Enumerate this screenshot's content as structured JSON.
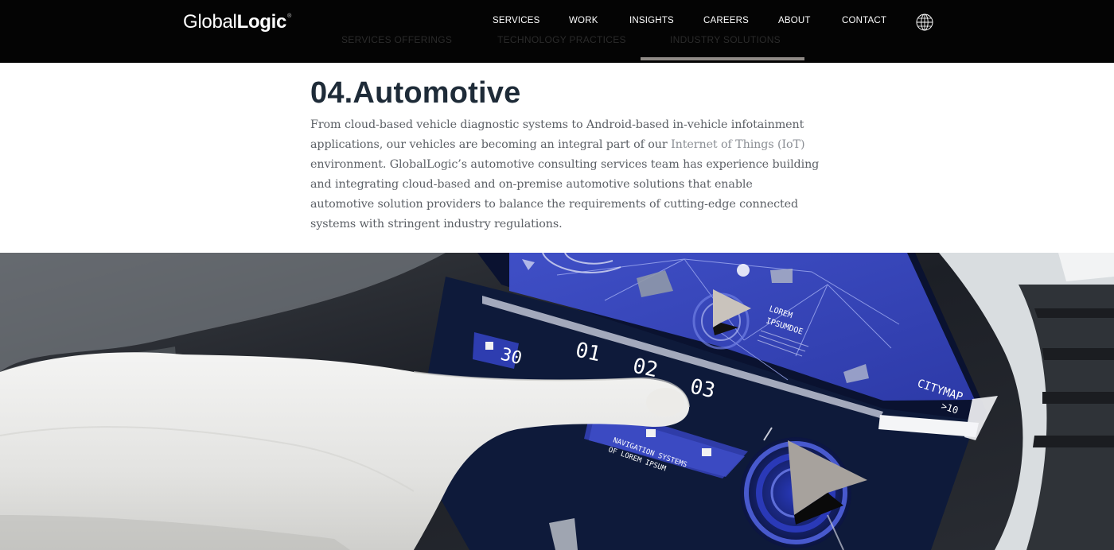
{
  "header": {
    "logo": {
      "light": "Global",
      "bold": "Logic",
      "mark": "®"
    },
    "nav": [
      "SERVICES",
      "WORK",
      "INSIGHTS",
      "CAREERS",
      "ABOUT",
      "CONTACT"
    ],
    "subnav": [
      "SERVICES OFFERINGS",
      "TECHNOLOGY PRACTICES",
      "INDUSTRY SOLUTIONS"
    ],
    "active_subnav": "INDUSTRY SOLUTIONS"
  },
  "section": {
    "title": "04.Automotive",
    "body_before_link": "From cloud-based vehicle diagnostic systems to Android-based in-vehicle infotainment applications, our vehicles are becoming an integral part of our ",
    "link_text": "Internet of Things (IoT)",
    "body_after_link": " environment. GlobalLogic’s automotive consulting services team has experience building and integrating cloud-based and on-premise automotive solutions that enable automotive solution providers to balance the requirements of cutting-edge connected systems with stringent industry regulations."
  },
  "hero": {
    "screen_labels": {
      "lorem": "LOREM",
      "ipsum": "IPSUMDOE",
      "citymap": "CITYMAP",
      "citymap_sub": ">10",
      "clock_a": "01",
      "clock_b": "02",
      "clock_c": "03",
      "left_num": "30",
      "nav_line1": "NAVIGATION SYSTEMS",
      "nav_line2": "OF LOREM IPSUM"
    }
  },
  "colors": {
    "header_bg": "#040404",
    "title": "#1e2b38",
    "body_text": "#5c6066",
    "screen_blue": "#3443b8",
    "underline": "#8f8a86"
  }
}
